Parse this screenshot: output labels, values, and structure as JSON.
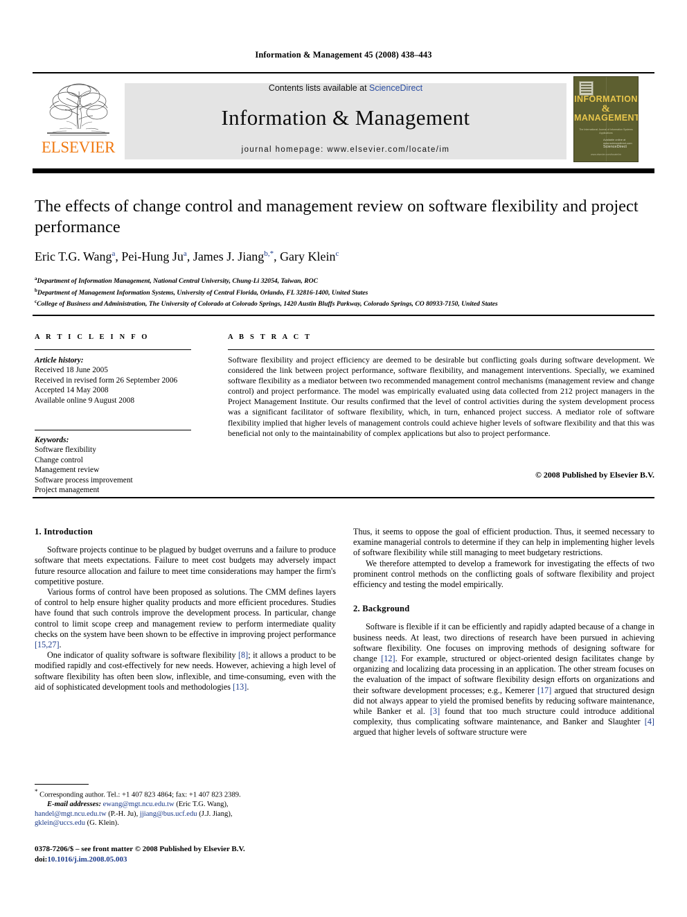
{
  "running_head": "Information & Management 45 (2008) 438–443",
  "masthead": {
    "contents_prefix": "Contents lists available at ",
    "sciencedirect": "ScienceDirect",
    "journal_title": "Information & Management",
    "homepage": "journal homepage: www.elsevier.com/locate/im",
    "publisher_logo_text": "ELSEVIER",
    "accent_orange": "#f07a13",
    "band_gray": "#e4e4e4",
    "link_blue": "#2b4ea2"
  },
  "cover": {
    "line1": "INFORMATION",
    "amp": "&",
    "line2": "MANAGEMENT",
    "subtitle": "The International Journal of Information Systems Applications",
    "sciencedirect_small": "ScienceDirect",
    "available_small": "Available online at www.sciencedirect.com",
    "footer": "www.elsevier.com/locate/im",
    "bg_color": "#5d5f30",
    "text_color": "#e8c64d"
  },
  "article": {
    "title": "The effects of change control and management review on software flexibility and project performance",
    "authors": [
      {
        "name": "Eric T.G. Wang",
        "marks": "a"
      },
      {
        "name": "Pei-Hung Ju",
        "marks": "a"
      },
      {
        "name": "James J. Jiang",
        "marks": "b,*"
      },
      {
        "name": "Gary Klein",
        "marks": "c"
      }
    ],
    "affiliations": [
      {
        "mark": "a",
        "text": "Department of Information Management, National Central University, Chung-Li 32054, Taiwan, ROC"
      },
      {
        "mark": "b",
        "text": "Department of Management Information Systems, University of Central Florida, Orlando, FL 32816-1400, United States"
      },
      {
        "mark": "c",
        "text": "College of Business and Administration, The University of Colorado at Colorado Springs, 1420 Austin Bluffs Parkway, Colorado Springs, CO 80933-7150, United States"
      }
    ]
  },
  "article_info": {
    "heading": "A R T I C L E   I N F O",
    "history_label": "Article history:",
    "history": [
      "Received 18 June 2005",
      "Received in revised form 26 September 2006",
      "Accepted 14 May 2008",
      "Available online 9 August 2008"
    ],
    "keywords_label": "Keywords:",
    "keywords": [
      "Software flexibility",
      "Change control",
      "Management review",
      "Software process improvement",
      "Project management"
    ]
  },
  "abstract": {
    "heading": "A B S T R A C T",
    "text": "Software flexibility and project efficiency are deemed to be desirable but conflicting goals during software development. We considered the link between project performance, software flexibility, and management interventions. Specially, we examined software flexibility as a mediator between two recommended management control mechanisms (management review and change control) and project performance. The model was empirically evaluated using data collected from 212 project managers in the Project Management Institute. Our results confirmed that the level of control activities during the system development process was a significant facilitator of software flexibility, which, in turn, enhanced project success. A mediator role of software flexibility implied that higher levels of management controls could achieve higher levels of software flexibility and that this was beneficial not only to the maintainability of complex applications but also to project performance.",
    "copyright": "© 2008 Published by Elsevier B.V."
  },
  "body": {
    "left": {
      "section1_heading": "1.  Introduction",
      "p1": "Software projects continue to be plagued by budget overruns and a failure to produce software that meets expectations. Failure to meet cost budgets may adversely impact future resource allocation and failure to meet time considerations may hamper the firm's competitive posture.",
      "p2_a": "Various forms of control have been proposed as solutions. The CMM defines layers of control to help ensure higher quality products and more efficient procedures. Studies have found that such controls improve the development process. In particular, change control to limit scope creep and management review to perform intermediate quality checks on the system have been shown to be effective in improving project performance ",
      "p2_ref": "[15,27]",
      "p2_b": ".",
      "p3_a": "One indicator of quality software is software flexibility ",
      "p3_ref1": "[8]",
      "p3_b": "; it allows a product to be modified rapidly and cost-effectively for new needs. However, achieving a high level of software flexibility has often been slow, inflexible, and time-consuming, even with the aid of sophisticated development tools and methodologies ",
      "p3_ref2": "[13]",
      "p3_c": "."
    },
    "right": {
      "p1": "Thus, it seems to oppose the goal of efficient production. Thus, it seemed necessary to examine managerial controls to determine if they can help in implementing higher levels of software flexibility while still managing to meet budgetary restrictions.",
      "p2": "We therefore attempted to develop a framework for investigating the effects of two prominent control methods on the conflicting goals of software flexibility and project efficiency and testing the model empirically.",
      "section2_heading": "2.  Background",
      "p3_a": "Software is flexible if it can be efficiently and rapidly adapted because of a change in business needs. At least, two directions of research have been pursued in achieving software flexibility. One focuses on improving methods of designing software for change ",
      "p3_ref1": "[12]",
      "p3_b": ". For example, structured or object-oriented design facilitates change by organizing and localizing data processing in an application. The other stream focuses on the evaluation of the impact of software flexibility design efforts on organizations and their software development processes; e.g., Kemerer ",
      "p3_ref2": "[17]",
      "p3_c": " argued that structured design did not always appear to yield the promised benefits by reducing software maintenance, while Banker et al. ",
      "p3_ref3": "[3]",
      "p3_d": " found that too much structure could introduce additional complexity, thus complicating software maintenance, and Banker and Slaughter ",
      "p3_ref4": "[4]",
      "p3_e": " argued that higher levels of software structure were"
    }
  },
  "footnotes": {
    "corresponding": "Corresponding author. Tel.: +1 407 823 4864; fax: +1 407 823 2389.",
    "email_label": "E-mail addresses:",
    "emails": [
      {
        "address": "ewang@mgt.ncu.edu.tw",
        "person": "(Eric T.G. Wang)"
      },
      {
        "address": "handel@mgt.ncu.edu.tw",
        "person": "(P.-H. Ju)"
      },
      {
        "address": "jjiang@bus.ucf.edu",
        "person": "(J.J. Jiang)"
      },
      {
        "address": "gklein@uccs.edu",
        "person": "(G. Klein)"
      }
    ]
  },
  "imprint": {
    "line1": "0378-7206/$ – see front matter © 2008 Published by Elsevier B.V.",
    "doi_label": "doi:",
    "doi_value": "10.1016/j.im.2008.05.003"
  }
}
